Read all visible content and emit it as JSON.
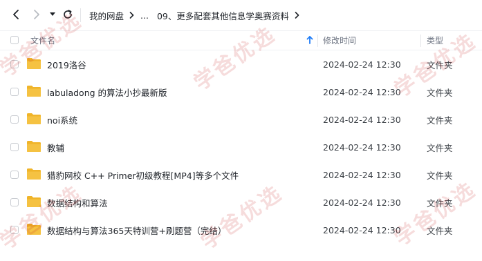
{
  "toolbar": {
    "back_icon": "chevron-left-icon",
    "forward_icon": "chevron-right-icon",
    "history_icon": "caret-down-icon",
    "refresh_icon": "refresh-icon"
  },
  "breadcrumb": {
    "root": "我的网盘",
    "ellipsis": "...",
    "current": "09、更多配套其他信息学奥赛资料"
  },
  "columns": {
    "name": "文件名",
    "modified": "修改时间",
    "type": "类型",
    "sort_icon": "arrow-up-icon"
  },
  "files": [
    {
      "name": "2019洛谷",
      "modified": "2024-02-24 12:30",
      "type": "文件夹"
    },
    {
      "name": "labuladong 的算法小抄最新版",
      "modified": "2024-02-24 12:30",
      "type": "文件夹"
    },
    {
      "name": "noi系统",
      "modified": "2024-02-24 12:30",
      "type": "文件夹"
    },
    {
      "name": "教辅",
      "modified": "2024-02-24 12:30",
      "type": "文件夹"
    },
    {
      "name": "猎豹网校 C++ Primer初级教程[MP4]等多个文件",
      "modified": "2024-02-24 12:30",
      "type": "文件夹"
    },
    {
      "name": "数据结构和算法",
      "modified": "2024-02-24 12:30",
      "type": "文件夹"
    },
    {
      "name": "数据结构与算法365天特训营+刷题营（完结）",
      "modified": "2024-02-24 12:30",
      "type": "文件夹"
    }
  ],
  "watermark": "学爸优选",
  "colors": {
    "folder": "#f5c242",
    "accent": "#1d7bf7",
    "watermark": "#c82828"
  }
}
